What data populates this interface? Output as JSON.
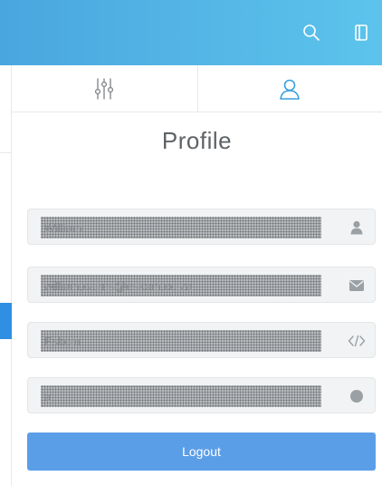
{
  "header": {
    "search_icon": "search-icon",
    "panel_toggle_icon": "panel-toggle-icon",
    "accent_color": "#4aa6df"
  },
  "tabs": [
    {
      "icon": "sliders-icon"
    },
    {
      "icon": "user-icon"
    }
  ],
  "profile": {
    "title": "Profile",
    "fields": [
      {
        "value": "William",
        "icon": "user-icon"
      },
      {
        "value": "william.cairns@eskom.co.za",
        "icon": "envelope-icon"
      },
      {
        "value": "Eskom",
        "icon": "code-icon"
      },
      {
        "value": "a",
        "icon": "circle-icon"
      }
    ]
  },
  "logout_label": "Logout",
  "logout_color": "#5b9ee8"
}
